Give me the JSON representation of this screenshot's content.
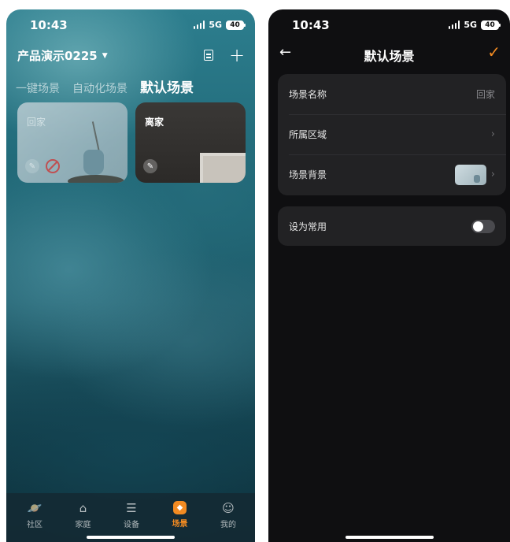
{
  "left": {
    "status": {
      "time": "10:43",
      "network": "5G",
      "battery": "40"
    },
    "header": {
      "home_name": "产品演示0225",
      "doc_icon": "document-icon",
      "add_icon": "plus-icon"
    },
    "tabs": [
      {
        "label": "一键场景",
        "active": false
      },
      {
        "label": "自动化场景",
        "active": false
      },
      {
        "label": "默认场景",
        "active": true
      }
    ],
    "scenes": [
      {
        "label": "回家",
        "disabled": true
      },
      {
        "label": "离家",
        "disabled": false
      }
    ],
    "tabbar": [
      {
        "label": "社区",
        "icon": "planet-icon"
      },
      {
        "label": "家庭",
        "icon": "house-icon"
      },
      {
        "label": "设备",
        "icon": "device-icon"
      },
      {
        "label": "场景",
        "icon": "scene-icon",
        "active": true
      },
      {
        "label": "我的",
        "icon": "profile-icon"
      }
    ],
    "accent": "#f28b22"
  },
  "right": {
    "status": {
      "time": "10:43",
      "network": "5G",
      "battery": "40"
    },
    "nav": {
      "title": "默认场景"
    },
    "rows": {
      "name_label": "场景名称",
      "name_value": "回家",
      "area_label": "所属区域",
      "background_label": "场景背景",
      "favorite_label": "设为常用"
    },
    "favorite_on": false
  }
}
